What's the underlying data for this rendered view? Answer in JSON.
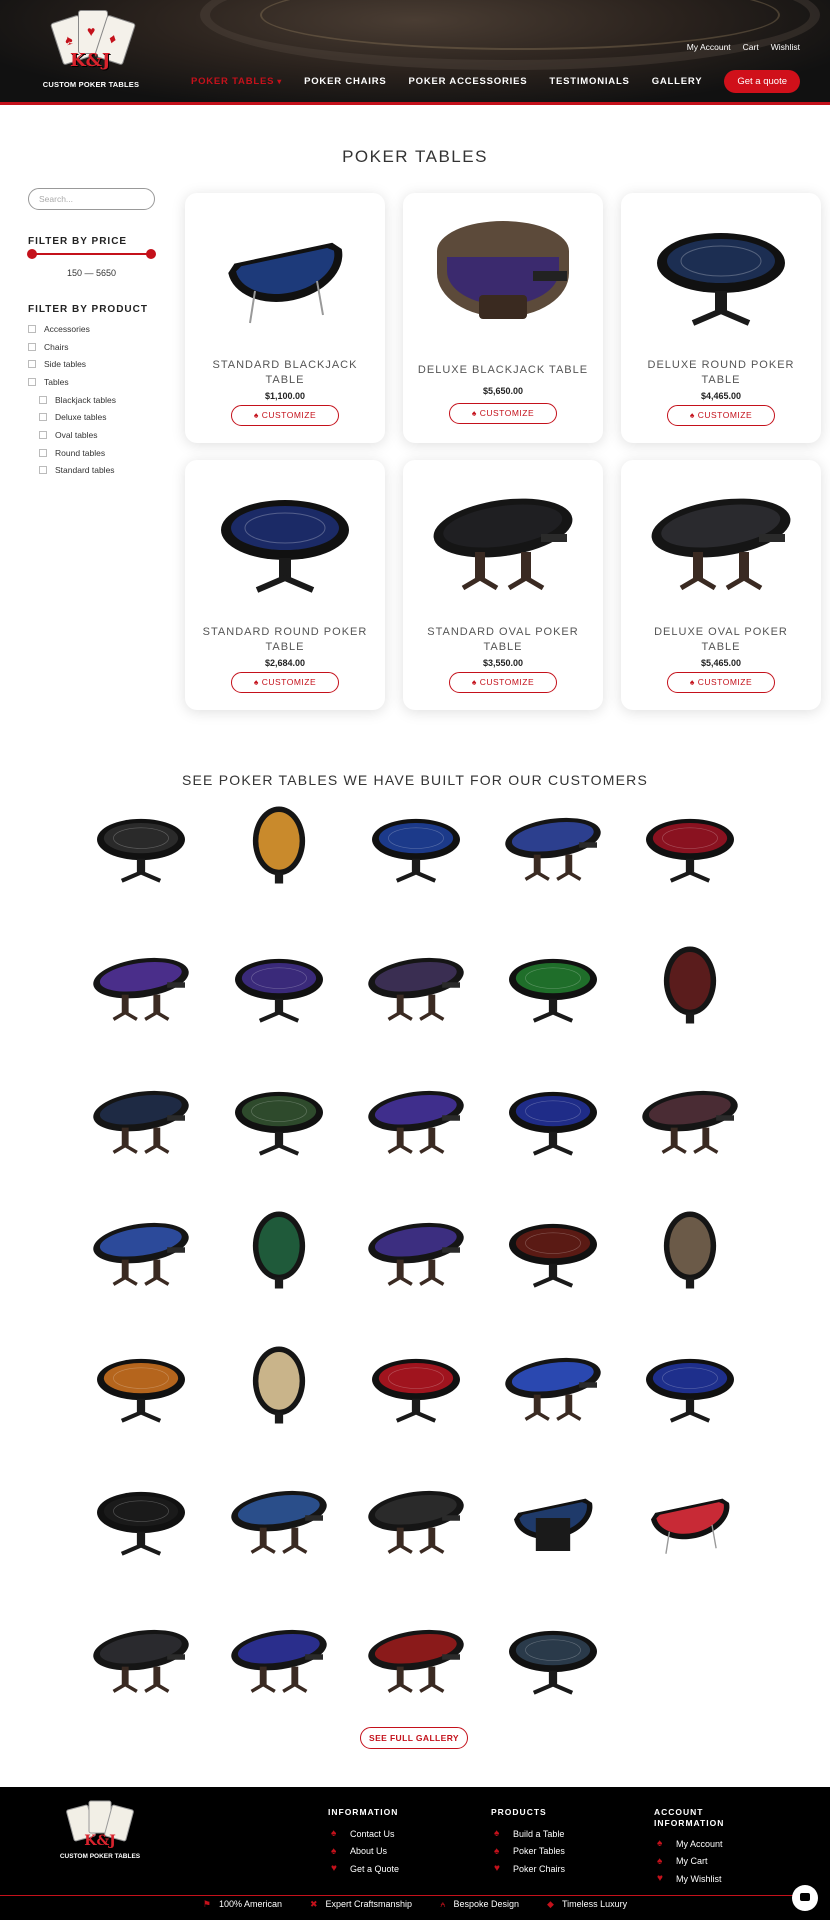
{
  "header": {
    "logo_brand": "CUSTOM POKER TABLES",
    "logo_initials": "K&J",
    "top_links": [
      "My Account",
      "Cart",
      "Wishlist"
    ],
    "nav": [
      {
        "label": "POKER TABLES",
        "active": true,
        "has_caret": true
      },
      {
        "label": "POKER CHAIRS"
      },
      {
        "label": "POKER ACCESSORIES"
      },
      {
        "label": "TESTIMONIALS"
      },
      {
        "label": "GALLERY"
      }
    ],
    "quote_button": "Get a quote",
    "accent_color": "#c4111b"
  },
  "page_title": "POKER TABLES",
  "sidebar": {
    "search_placeholder": "Search...",
    "filter_price_heading": "FILTER BY PRICE",
    "price_range": "150 — 5650",
    "filter_product_heading": "FILTER BY PRODUCT",
    "filters": [
      {
        "label": "Accessories",
        "sub": false
      },
      {
        "label": "Chairs",
        "sub": false
      },
      {
        "label": "Side tables",
        "sub": false
      },
      {
        "label": "Tables",
        "sub": false
      },
      {
        "label": "Blackjack tables",
        "sub": true
      },
      {
        "label": "Deluxe tables",
        "sub": true
      },
      {
        "label": "Oval tables",
        "sub": true
      },
      {
        "label": "Round tables",
        "sub": true
      },
      {
        "label": "Standard tables",
        "sub": true
      }
    ]
  },
  "products": [
    {
      "name_line1": "STANDARD BLACKJACK",
      "name_line2": "TABLE",
      "price": "$1,100.00",
      "cta": "CUSTOMIZE",
      "shape": "blackjack",
      "felt": "#1d3a7a"
    },
    {
      "name_line1": "DELUXE BLACKJACK TABLE",
      "name_line2": "",
      "price": "$5,650.00",
      "cta": "CUSTOMIZE",
      "shape": "deluxe-blackjack",
      "felt": "#3b2a6e"
    },
    {
      "name_line1": "DELUXE ROUND POKER",
      "name_line2": "TABLE",
      "price": "$4,465.00",
      "cta": "CUSTOMIZE",
      "shape": "round",
      "felt": "#1c2e52"
    },
    {
      "name_line1": "STANDARD ROUND POKER",
      "name_line2": "TABLE",
      "price": "$2,684.00",
      "cta": "CUSTOMIZE",
      "shape": "round",
      "felt": "#1b2a66"
    },
    {
      "name_line1": "STANDARD OVAL POKER",
      "name_line2": "TABLE",
      "price": "$3,550.00",
      "cta": "CUSTOMIZE",
      "shape": "oval",
      "felt": "#1f1f22"
    },
    {
      "name_line1": "DELUXE OVAL POKER",
      "name_line2": "TABLE",
      "price": "$5,465.00",
      "cta": "CUSTOMIZE",
      "shape": "oval",
      "felt": "#2a2a2e"
    }
  ],
  "gallery": {
    "title": "SEE POKER TABLES WE HAVE BUILT FOR OUR CUSTOMERS",
    "items": [
      {
        "shape": "round",
        "felt": "#2a2a2a"
      },
      {
        "shape": "oval-v",
        "felt": "#c98a2c"
      },
      {
        "shape": "round",
        "felt": "#1c3a8a"
      },
      {
        "shape": "oval",
        "felt": "#2c3f8e"
      },
      {
        "shape": "round",
        "felt": "#8a1220"
      },
      {
        "shape": "oval",
        "felt": "#4a2e8a"
      },
      {
        "shape": "round",
        "felt": "#3a2a7a"
      },
      {
        "shape": "oval",
        "felt": "#3a2e52"
      },
      {
        "shape": "round",
        "felt": "#1f6e2a"
      },
      {
        "shape": "oval-v",
        "felt": "#5a1c1c"
      },
      {
        "shape": "oval",
        "felt": "#1e2a44"
      },
      {
        "shape": "round",
        "felt": "#2e4a2c"
      },
      {
        "shape": "oval",
        "felt": "#3f2e8c"
      },
      {
        "shape": "round",
        "felt": "#1f2c88"
      },
      {
        "shape": "oval",
        "felt": "#4a2c34"
      },
      {
        "shape": "oval",
        "felt": "#2c4a9a"
      },
      {
        "shape": "oval-v",
        "felt": "#1f5a3a"
      },
      {
        "shape": "oval",
        "felt": "#3c2e80"
      },
      {
        "shape": "round",
        "felt": "#5a1a14"
      },
      {
        "shape": "oval-v",
        "felt": "#6b5a48"
      },
      {
        "shape": "round",
        "felt": "#b5651d"
      },
      {
        "shape": "oval-v",
        "felt": "#c9b48a"
      },
      {
        "shape": "round",
        "felt": "#a0141e"
      },
      {
        "shape": "oval",
        "felt": "#2a48b0"
      },
      {
        "shape": "round",
        "felt": "#1e2f8c"
      },
      {
        "shape": "round",
        "felt": "#1a1a1a"
      },
      {
        "shape": "oval",
        "felt": "#2a4e8a"
      },
      {
        "shape": "oval",
        "felt": "#2a2a2a"
      },
      {
        "shape": "blackjack-d",
        "felt": "#1f3a6a"
      },
      {
        "shape": "blackjack",
        "felt": "#c82a36"
      },
      {
        "shape": "oval",
        "felt": "#2a2a2e"
      },
      {
        "shape": "oval",
        "felt": "#2a2e8c"
      },
      {
        "shape": "oval",
        "felt": "#8a1a1a"
      },
      {
        "shape": "round",
        "felt": "#2a3a4a"
      }
    ],
    "full_gallery_button": "SEE FULL GALLERY"
  },
  "footer": {
    "columns": [
      {
        "heading_line1": "INFORMATION",
        "heading_line2": "",
        "links": [
          "Contact Us",
          "About Us",
          "Get a Quote"
        ]
      },
      {
        "heading_line1": "PRODUCTS",
        "heading_line2": "",
        "links": [
          "Build a Table",
          "Poker Tables",
          "Poker Chairs"
        ]
      },
      {
        "heading_line1": "ACCOUNT",
        "heading_line2": "INFORMATION",
        "links": [
          "My Account",
          "My Cart",
          "My Wishlist"
        ]
      }
    ],
    "badges": [
      "100% American",
      "Expert Craftsmanship",
      "Bespoke Design",
      "Timeless Luxury"
    ]
  }
}
